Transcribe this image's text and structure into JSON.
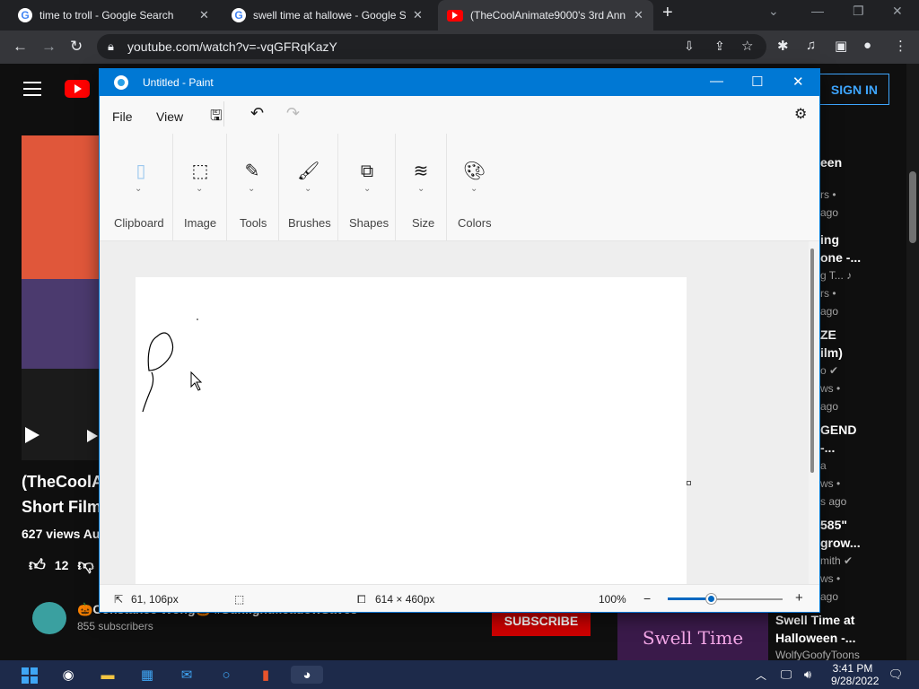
{
  "browser": {
    "tabs": [
      {
        "title": "time to troll - Google Search",
        "icon": "google-icon"
      },
      {
        "title": "swell time at hallowe - Google Sea",
        "icon": "google-icon"
      },
      {
        "title": "(TheCoolAnimate9000's 3rd Ann",
        "icon": "youtube-icon",
        "active": true
      }
    ],
    "url": "youtube.com/watch?v=-vqGFRqKazY"
  },
  "youtube": {
    "signin_label": "SIGN IN",
    "video_title_line1": "(TheCoolA",
    "video_title_line2": "Short Film",
    "views": "627 views  Au",
    "likes": "12",
    "channel_name": "🎃Constance Wong🎃 #SunlightMeadowSaves",
    "subscribers": "855 subscribers",
    "subscribe_label": "SUBSCRIBE",
    "sidebar_fragments": [
      {
        "text": "een",
        "meta": false
      },
      {
        "text": "rs •",
        "meta": true
      },
      {
        "text": "ago",
        "meta": true
      },
      {
        "text": "ing",
        "meta": false
      },
      {
        "text": "one -...",
        "meta": false
      },
      {
        "text": "g T... ♪",
        "meta": true
      },
      {
        "text": "rs •",
        "meta": true
      },
      {
        "text": "ago",
        "meta": true
      },
      {
        "text": "ZE",
        "meta": false
      },
      {
        "text": "ilm)",
        "meta": false
      },
      {
        "text": "o ✔",
        "meta": true
      },
      {
        "text": "ws •",
        "meta": true
      },
      {
        "text": "ago",
        "meta": true
      },
      {
        "text": "GEND",
        "meta": false
      },
      {
        "text": "-...",
        "meta": false
      },
      {
        "text": "a",
        "meta": true
      },
      {
        "text": "ws •",
        "meta": true
      },
      {
        "text": "s ago",
        "meta": true
      },
      {
        "text": "585\"",
        "meta": false
      },
      {
        "text": "grow...",
        "meta": false
      },
      {
        "text": "mith ✔",
        "meta": true
      },
      {
        "text": "ws •",
        "meta": true
      },
      {
        "text": "ago",
        "meta": true
      }
    ],
    "sidebar_thumb_text": "Swell Time",
    "sidebar_title2": "Swell Time at Halloween -...",
    "sidebar_channel2": "WolfyGoofyToons"
  },
  "paint": {
    "window_title": "Untitled - Paint",
    "menu": {
      "file": "File",
      "view": "View"
    },
    "ribbon_groups": [
      "Clipboard",
      "Image",
      "Tools",
      "Brushes",
      "Shapes",
      "Size",
      "Colors"
    ],
    "status": {
      "cursor_position": "61, 106px",
      "canvas_size": "614 × 460px",
      "zoom": "100%"
    },
    "zoom_level_fraction": 0.375
  },
  "taskbar": {
    "time": "3:41 PM",
    "date": "9/28/2022"
  }
}
